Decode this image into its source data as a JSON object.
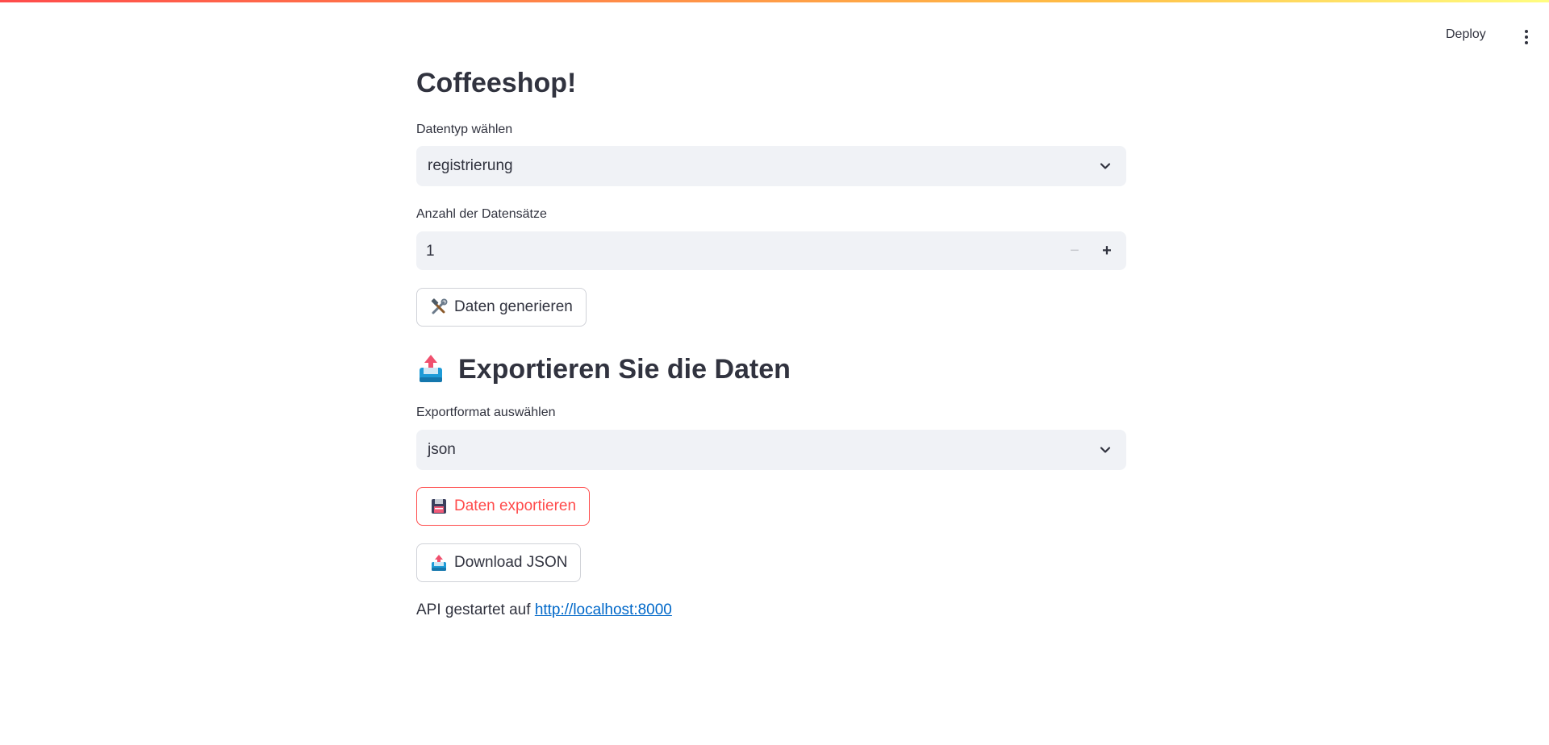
{
  "header": {
    "deploy_label": "Deploy",
    "menu_icon": "kebab-menu-icon"
  },
  "main": {
    "title": "Coffeeshop!",
    "datatype": {
      "label": "Datentyp wählen",
      "selected": "registrierung"
    },
    "count": {
      "label": "Anzahl der Datensätze",
      "value": "1",
      "minus": "−",
      "plus": "+"
    },
    "generate_button": {
      "icon": "hammer-and-wrench-icon",
      "label": "Daten generieren"
    },
    "export_section": {
      "icon": "outbox-tray-icon",
      "title": "Exportieren Sie die Daten"
    },
    "export_format": {
      "label": "Exportformat auswählen",
      "selected": "json"
    },
    "export_button": {
      "icon": "floppy-disk-icon",
      "label": "Daten exportieren"
    },
    "download_button": {
      "icon": "outbox-tray-icon",
      "label": "Download JSON"
    },
    "api": {
      "prefix": "API gestartet auf",
      "link": "http://localhost:8000"
    }
  },
  "colors": {
    "accent": "#ff4b4b",
    "input_bg": "#f0f2f6",
    "text": "#31333f",
    "link": "#0068c9"
  }
}
